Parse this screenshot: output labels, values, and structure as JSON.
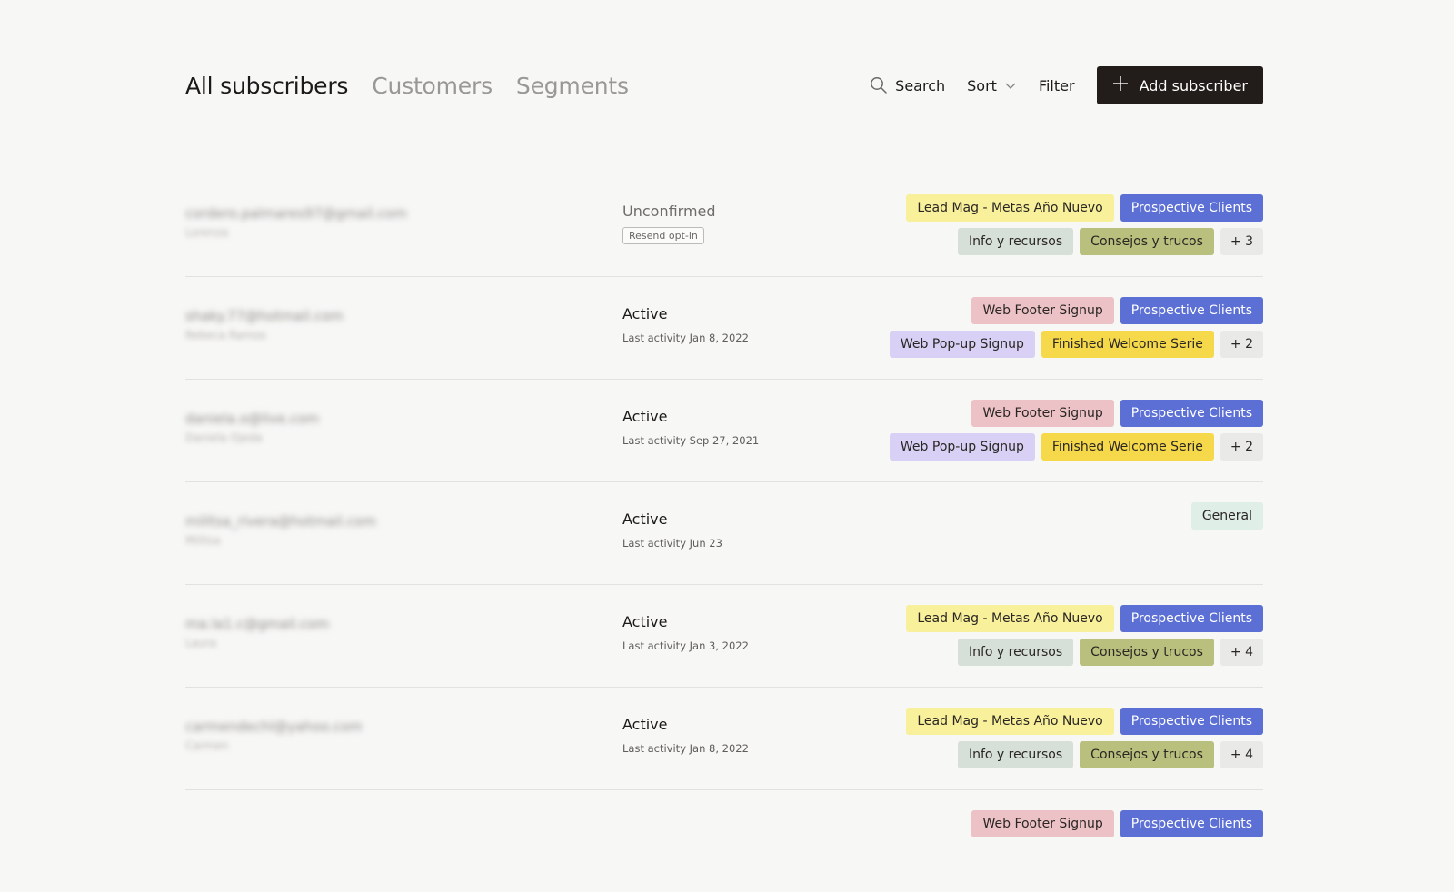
{
  "tabs": [
    {
      "label": "All subscribers",
      "active": true
    },
    {
      "label": "Customers",
      "active": false
    },
    {
      "label": "Segments",
      "active": false
    }
  ],
  "toolbar": {
    "search_label": "Search",
    "sort_label": "Sort",
    "filter_label": "Filter",
    "add_label": "Add subscriber"
  },
  "tag_colors": {
    "yellow": "#f8f09a",
    "blue": "#5b6fd4",
    "grey": "#d6dfd8",
    "olive": "#b9bf7c",
    "pink": "#edc2c6",
    "lavender": "#d8d0f5",
    "gold": "#f6d94a",
    "mint": "#dfeee6",
    "light": "#e9e9e7"
  },
  "rows": [
    {
      "email": "cordero.palmares97@gmail.com",
      "name": "Lorenza",
      "status": "Unconfirmed",
      "resend": "Resend opt-in",
      "activity": "",
      "tags": [
        [
          {
            "label": "Lead Mag - Metas Año Nuevo",
            "color": "yellow"
          },
          {
            "label": "Prospective Clients",
            "color": "blue"
          }
        ],
        [
          {
            "label": "Info y recursos",
            "color": "grey"
          },
          {
            "label": "Consejos y trucos",
            "color": "olive"
          },
          {
            "label": "+ 3",
            "color": "light"
          }
        ]
      ]
    },
    {
      "email": "shaky.77@hotmail.com",
      "name": "Rebeca Ramos",
      "status": "Active",
      "resend": "",
      "activity": "Last activity Jan 8, 2022",
      "tags": [
        [
          {
            "label": "Web Footer Signup",
            "color": "pink"
          },
          {
            "label": "Prospective Clients",
            "color": "blue"
          }
        ],
        [
          {
            "label": "Web Pop-up Signup",
            "color": "lavender"
          },
          {
            "label": "Finished Welcome Serie",
            "color": "gold"
          },
          {
            "label": "+ 2",
            "color": "light"
          }
        ]
      ]
    },
    {
      "email": "daniela.o@live.com",
      "name": "Daniela Ojeda",
      "status": "Active",
      "resend": "",
      "activity": "Last activity Sep 27, 2021",
      "tags": [
        [
          {
            "label": "Web Footer Signup",
            "color": "pink"
          },
          {
            "label": "Prospective Clients",
            "color": "blue"
          }
        ],
        [
          {
            "label": "Web Pop-up Signup",
            "color": "lavender"
          },
          {
            "label": "Finished Welcome Serie",
            "color": "gold"
          },
          {
            "label": "+ 2",
            "color": "light"
          }
        ]
      ]
    },
    {
      "email": "militsa_rivera@hotmail.com",
      "name": "Militsa",
      "status": "Active",
      "resend": "",
      "activity": "Last activity Jun 23",
      "tags": [
        [
          {
            "label": "General",
            "color": "mint"
          }
        ]
      ]
    },
    {
      "email": "ma.la1.c@gmail.com",
      "name": "Laura",
      "status": "Active",
      "resend": "",
      "activity": "Last activity Jan 3, 2022",
      "tags": [
        [
          {
            "label": "Lead Mag - Metas Año Nuevo",
            "color": "yellow"
          },
          {
            "label": "Prospective Clients",
            "color": "blue"
          }
        ],
        [
          {
            "label": "Info y recursos",
            "color": "grey"
          },
          {
            "label": "Consejos y trucos",
            "color": "olive"
          },
          {
            "label": "+ 4",
            "color": "light"
          }
        ]
      ]
    },
    {
      "email": "carmendechl@yahoo.com",
      "name": "Carmen",
      "status": "Active",
      "resend": "",
      "activity": "Last activity Jan 8, 2022",
      "tags": [
        [
          {
            "label": "Lead Mag - Metas Año Nuevo",
            "color": "yellow"
          },
          {
            "label": "Prospective Clients",
            "color": "blue"
          }
        ],
        [
          {
            "label": "Info y recursos",
            "color": "grey"
          },
          {
            "label": "Consejos y trucos",
            "color": "olive"
          },
          {
            "label": "+ 4",
            "color": "light"
          }
        ]
      ]
    },
    {
      "email": "",
      "name": "",
      "status": "",
      "resend": "",
      "activity": "",
      "tags": [
        [
          {
            "label": "Web Footer Signup",
            "color": "pink"
          },
          {
            "label": "Prospective Clients",
            "color": "blue"
          }
        ]
      ]
    }
  ]
}
